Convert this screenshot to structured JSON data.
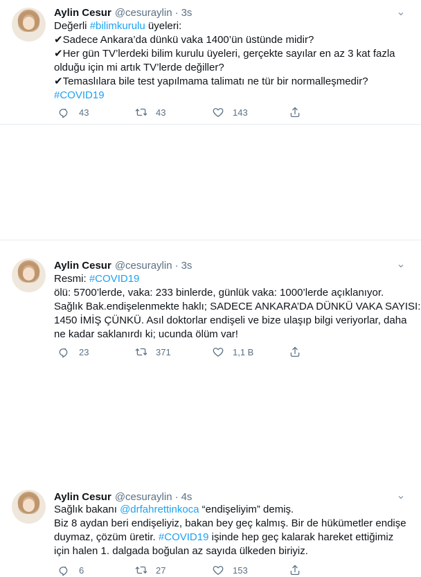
{
  "tweets": [
    {
      "name": "Aylin Cesur",
      "handle": "@cesuraylin",
      "separator": "·",
      "time": "3s",
      "lines": [
        [
          "Değerli ",
          {
            "link": "#bilimkurulu"
          },
          " üyeleri:"
        ],
        [
          "✔Sadece Ankara’da dünkü vaka 1400’ün üstünde midir?"
        ],
        [
          "✔Her gün TV’lerdeki bilim kurulu üyeleri, gerçekte sayılar en az 3 kat fazla"
        ],
        [
          "olduğu için mi artık TV’lerde değiller?"
        ],
        [
          "✔Temaslılara bile test yapılmama talimatı ne tür bir normalleşmedir?"
        ],
        [
          {
            "link": "#COVID19"
          }
        ]
      ],
      "replies": "43",
      "retweets": "43",
      "likes": "143"
    },
    {
      "name": "Aylin Cesur",
      "handle": "@cesuraylin",
      "separator": "·",
      "time": "3s",
      "lines": [
        [
          "Resmi: ",
          {
            "link": "#COVID19"
          }
        ],
        [
          "ölü: 5700’lerde, vaka: 233 binlerde, günlük vaka: 1000’lerde açıklanıyor."
        ],
        [
          "Sağlık Bak.endişelenmekte haklı; SADECE ANKARA’DA DÜNKÜ VAKA SAYISI:"
        ],
        [
          "1450 İMİŞ ÇÜNKÜ. Asıl doktorlar endişeli ve bize ulaşıp bilgi veriyorlar, daha"
        ],
        [
          "ne kadar saklanırdı ki; ucunda ölüm var!"
        ]
      ],
      "replies": "23",
      "retweets": "371",
      "likes": "1,1 B"
    },
    {
      "name": "Aylin Cesur",
      "handle": "@cesuraylin",
      "separator": "·",
      "time": "4s",
      "lines": [
        [
          "Sağlık bakanı ",
          {
            "link": "@drfahrettinkoca"
          },
          " “endişeliyim” demiş."
        ],
        [
          "Biz 8 aydan beri endişeliyiz, bakan bey geç kalmış. Bir de hükümetler endişe"
        ],
        [
          "duymaz, çözüm üretir. ",
          {
            "link": "#COVID19"
          },
          " işinde hep geç kalarak hareket ettiğimiz"
        ],
        [
          "için halen 1. dalgada boğulan az sayıda ülkeden biriyiz."
        ]
      ],
      "replies": "6",
      "retweets": "27",
      "likes": "153"
    }
  ],
  "colors": {
    "link": "#1da1f2",
    "muted": "#5b7083",
    "text": "#0f1419",
    "divider": "#e6ecf0"
  },
  "icons": [
    "reply-icon",
    "retweet-icon",
    "like-icon",
    "share-icon",
    "caret-down-icon"
  ]
}
